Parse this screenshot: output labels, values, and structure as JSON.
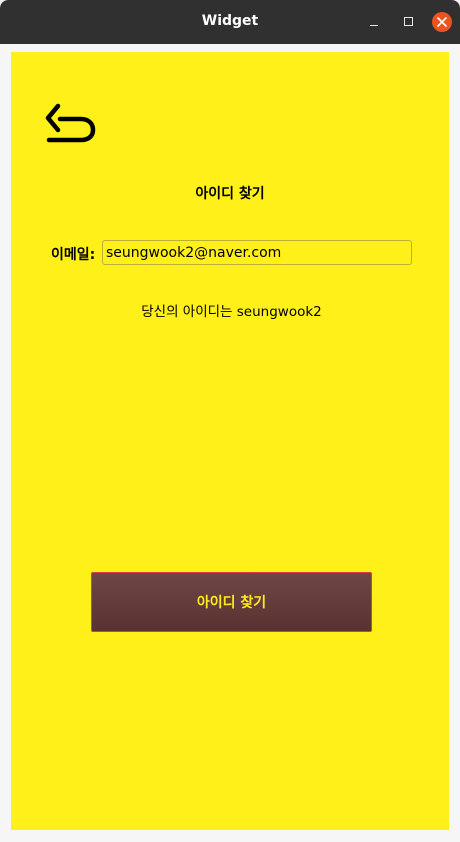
{
  "window": {
    "title": "Widget"
  },
  "icons": {
    "back": "back-arrow-icon",
    "minimize": "minimize-icon",
    "maximize": "maximize-icon",
    "close": "close-icon"
  },
  "colors": {
    "background": "#fff01a",
    "button_bg": "#5e3838",
    "button_text": "#ffeb1a",
    "button_border": "#e0393e",
    "close_button": "#e95420"
  },
  "page": {
    "title": "아이디 찾기",
    "email_label": "이메일:",
    "email_value": "seungwook2@naver.com",
    "result_text": "당신의 아이디는 seungwook2",
    "find_button_label": "아이디 찾기"
  }
}
